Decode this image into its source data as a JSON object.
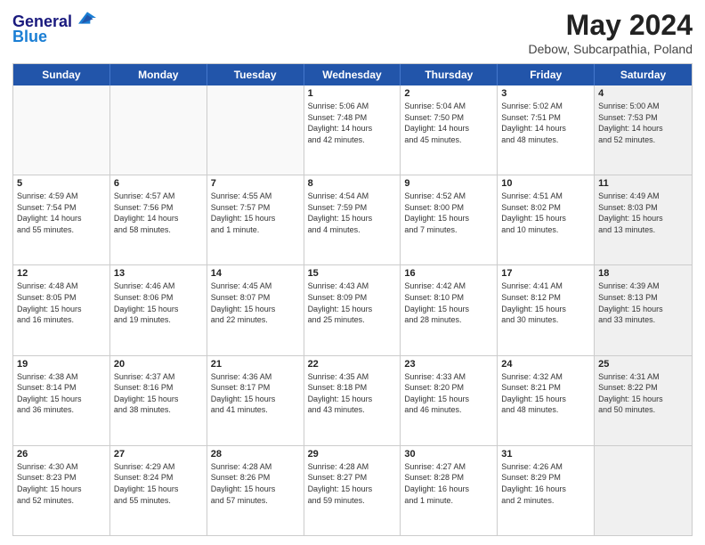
{
  "header": {
    "logo_line1": "General",
    "logo_line2": "Blue",
    "month": "May 2024",
    "location": "Debow, Subcarpathia, Poland"
  },
  "weekdays": [
    "Sunday",
    "Monday",
    "Tuesday",
    "Wednesday",
    "Thursday",
    "Friday",
    "Saturday"
  ],
  "rows": [
    [
      {
        "day": "",
        "text": "",
        "empty": true
      },
      {
        "day": "",
        "text": "",
        "empty": true
      },
      {
        "day": "",
        "text": "",
        "empty": true
      },
      {
        "day": "1",
        "text": "Sunrise: 5:06 AM\nSunset: 7:48 PM\nDaylight: 14 hours\nand 42 minutes."
      },
      {
        "day": "2",
        "text": "Sunrise: 5:04 AM\nSunset: 7:50 PM\nDaylight: 14 hours\nand 45 minutes."
      },
      {
        "day": "3",
        "text": "Sunrise: 5:02 AM\nSunset: 7:51 PM\nDaylight: 14 hours\nand 48 minutes."
      },
      {
        "day": "4",
        "text": "Sunrise: 5:00 AM\nSunset: 7:53 PM\nDaylight: 14 hours\nand 52 minutes.",
        "shaded": true
      }
    ],
    [
      {
        "day": "5",
        "text": "Sunrise: 4:59 AM\nSunset: 7:54 PM\nDaylight: 14 hours\nand 55 minutes."
      },
      {
        "day": "6",
        "text": "Sunrise: 4:57 AM\nSunset: 7:56 PM\nDaylight: 14 hours\nand 58 minutes."
      },
      {
        "day": "7",
        "text": "Sunrise: 4:55 AM\nSunset: 7:57 PM\nDaylight: 15 hours\nand 1 minute."
      },
      {
        "day": "8",
        "text": "Sunrise: 4:54 AM\nSunset: 7:59 PM\nDaylight: 15 hours\nand 4 minutes."
      },
      {
        "day": "9",
        "text": "Sunrise: 4:52 AM\nSunset: 8:00 PM\nDaylight: 15 hours\nand 7 minutes."
      },
      {
        "day": "10",
        "text": "Sunrise: 4:51 AM\nSunset: 8:02 PM\nDaylight: 15 hours\nand 10 minutes."
      },
      {
        "day": "11",
        "text": "Sunrise: 4:49 AM\nSunset: 8:03 PM\nDaylight: 15 hours\nand 13 minutes.",
        "shaded": true
      }
    ],
    [
      {
        "day": "12",
        "text": "Sunrise: 4:48 AM\nSunset: 8:05 PM\nDaylight: 15 hours\nand 16 minutes."
      },
      {
        "day": "13",
        "text": "Sunrise: 4:46 AM\nSunset: 8:06 PM\nDaylight: 15 hours\nand 19 minutes."
      },
      {
        "day": "14",
        "text": "Sunrise: 4:45 AM\nSunset: 8:07 PM\nDaylight: 15 hours\nand 22 minutes."
      },
      {
        "day": "15",
        "text": "Sunrise: 4:43 AM\nSunset: 8:09 PM\nDaylight: 15 hours\nand 25 minutes."
      },
      {
        "day": "16",
        "text": "Sunrise: 4:42 AM\nSunset: 8:10 PM\nDaylight: 15 hours\nand 28 minutes."
      },
      {
        "day": "17",
        "text": "Sunrise: 4:41 AM\nSunset: 8:12 PM\nDaylight: 15 hours\nand 30 minutes."
      },
      {
        "day": "18",
        "text": "Sunrise: 4:39 AM\nSunset: 8:13 PM\nDaylight: 15 hours\nand 33 minutes.",
        "shaded": true
      }
    ],
    [
      {
        "day": "19",
        "text": "Sunrise: 4:38 AM\nSunset: 8:14 PM\nDaylight: 15 hours\nand 36 minutes."
      },
      {
        "day": "20",
        "text": "Sunrise: 4:37 AM\nSunset: 8:16 PM\nDaylight: 15 hours\nand 38 minutes."
      },
      {
        "day": "21",
        "text": "Sunrise: 4:36 AM\nSunset: 8:17 PM\nDaylight: 15 hours\nand 41 minutes."
      },
      {
        "day": "22",
        "text": "Sunrise: 4:35 AM\nSunset: 8:18 PM\nDaylight: 15 hours\nand 43 minutes."
      },
      {
        "day": "23",
        "text": "Sunrise: 4:33 AM\nSunset: 8:20 PM\nDaylight: 15 hours\nand 46 minutes."
      },
      {
        "day": "24",
        "text": "Sunrise: 4:32 AM\nSunset: 8:21 PM\nDaylight: 15 hours\nand 48 minutes."
      },
      {
        "day": "25",
        "text": "Sunrise: 4:31 AM\nSunset: 8:22 PM\nDaylight: 15 hours\nand 50 minutes.",
        "shaded": true
      }
    ],
    [
      {
        "day": "26",
        "text": "Sunrise: 4:30 AM\nSunset: 8:23 PM\nDaylight: 15 hours\nand 52 minutes."
      },
      {
        "day": "27",
        "text": "Sunrise: 4:29 AM\nSunset: 8:24 PM\nDaylight: 15 hours\nand 55 minutes."
      },
      {
        "day": "28",
        "text": "Sunrise: 4:28 AM\nSunset: 8:26 PM\nDaylight: 15 hours\nand 57 minutes."
      },
      {
        "day": "29",
        "text": "Sunrise: 4:28 AM\nSunset: 8:27 PM\nDaylight: 15 hours\nand 59 minutes."
      },
      {
        "day": "30",
        "text": "Sunrise: 4:27 AM\nSunset: 8:28 PM\nDaylight: 16 hours\nand 1 minute."
      },
      {
        "day": "31",
        "text": "Sunrise: 4:26 AM\nSunset: 8:29 PM\nDaylight: 16 hours\nand 2 minutes."
      },
      {
        "day": "",
        "text": "",
        "empty": true,
        "shaded": true
      }
    ]
  ]
}
